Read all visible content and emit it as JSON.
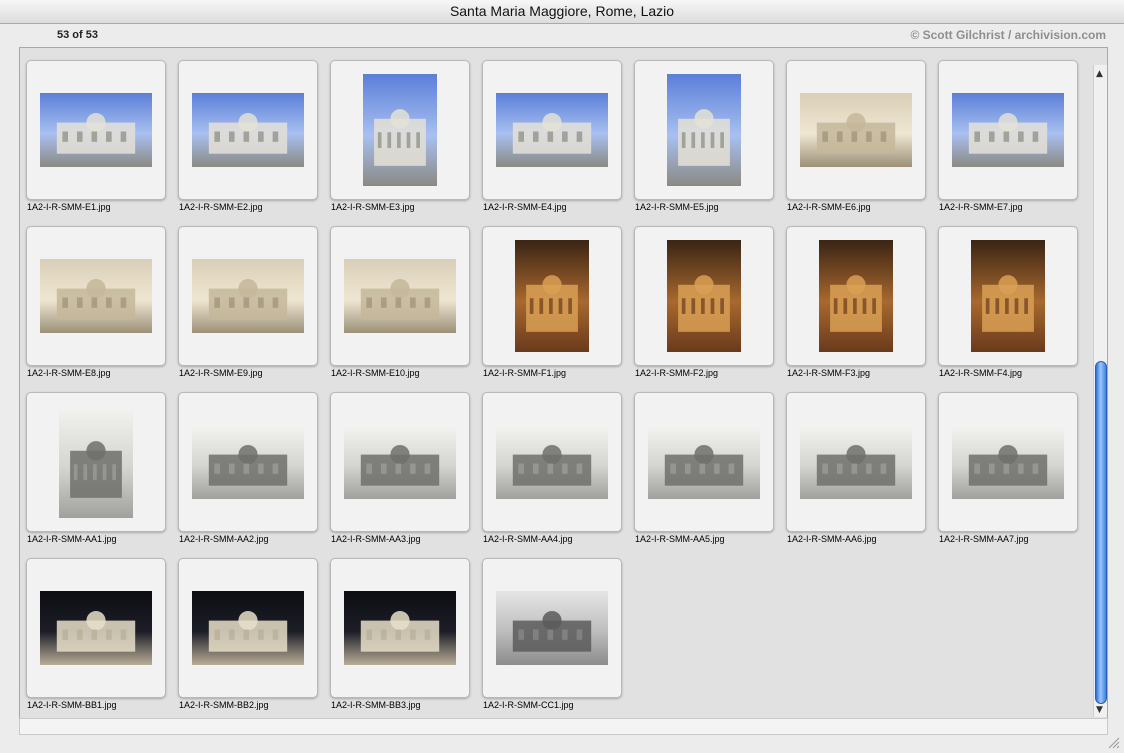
{
  "window": {
    "title": "Santa Maria Maggiore, Rome, Lazio"
  },
  "header": {
    "count": "53 of 53",
    "copyright": "© Scott Gilchrist / archivision.com"
  },
  "icons": {
    "scroll_up": "scroll-up-arrow-icon",
    "scroll_down": "scroll-down-arrow-icon",
    "resize": "resize-grip-icon"
  },
  "scrollbar": {
    "up_glyph": "▲",
    "down_glyph": "▼"
  },
  "grid": {
    "items": [
      {
        "file": "1A2-I-R-SMM-E1.jpg",
        "o": "l",
        "k": "exterior-photo"
      },
      {
        "file": "1A2-I-R-SMM-E2.jpg",
        "o": "l",
        "k": "exterior-photo"
      },
      {
        "file": "1A2-I-R-SMM-E3.jpg",
        "o": "p",
        "k": "exterior-photo"
      },
      {
        "file": "1A2-I-R-SMM-E4.jpg",
        "o": "l",
        "k": "exterior-photo"
      },
      {
        "file": "1A2-I-R-SMM-E5.jpg",
        "o": "p",
        "k": "exterior-photo"
      },
      {
        "file": "1A2-I-R-SMM-E6.jpg",
        "o": "l",
        "k": "facade-photo"
      },
      {
        "file": "1A2-I-R-SMM-E7.jpg",
        "o": "l",
        "k": "exterior-photo"
      },
      {
        "file": "1A2-I-R-SMM-E8.jpg",
        "o": "l",
        "k": "facade-photo"
      },
      {
        "file": "1A2-I-R-SMM-E9.jpg",
        "o": "l",
        "k": "facade-photo"
      },
      {
        "file": "1A2-I-R-SMM-E10.jpg",
        "o": "l",
        "k": "facade-photo"
      },
      {
        "file": "1A2-I-R-SMM-F1.jpg",
        "o": "p",
        "k": "interior-photo"
      },
      {
        "file": "1A2-I-R-SMM-F2.jpg",
        "o": "p",
        "k": "interior-photo"
      },
      {
        "file": "1A2-I-R-SMM-F3.jpg",
        "o": "p",
        "k": "interior-photo"
      },
      {
        "file": "1A2-I-R-SMM-F4.jpg",
        "o": "p",
        "k": "interior-photo"
      },
      {
        "file": "1A2-I-R-SMM-AA1.jpg",
        "o": "p",
        "k": "engraving"
      },
      {
        "file": "1A2-I-R-SMM-AA2.jpg",
        "o": "l",
        "k": "engraving"
      },
      {
        "file": "1A2-I-R-SMM-AA3.jpg",
        "o": "l",
        "k": "engraving"
      },
      {
        "file": "1A2-I-R-SMM-AA4.jpg",
        "o": "l",
        "k": "engraving"
      },
      {
        "file": "1A2-I-R-SMM-AA5.jpg",
        "o": "l",
        "k": "engraving"
      },
      {
        "file": "1A2-I-R-SMM-AA6.jpg",
        "o": "l",
        "k": "engraving"
      },
      {
        "file": "1A2-I-R-SMM-AA7.jpg",
        "o": "l",
        "k": "engraving"
      },
      {
        "file": "1A2-I-R-SMM-BB1.jpg",
        "o": "l",
        "k": "model-photo"
      },
      {
        "file": "1A2-I-R-SMM-BB2.jpg",
        "o": "l",
        "k": "model-photo"
      },
      {
        "file": "1A2-I-R-SMM-BB3.jpg",
        "o": "l",
        "k": "model-photo"
      },
      {
        "file": "1A2-I-R-SMM-CC1.jpg",
        "o": "l",
        "k": "bw-photo"
      }
    ]
  },
  "colors": {
    "exterior-photo": [
      "#5b7fd8",
      "#a8bff0",
      "#e4e0d6",
      "#8a8a82"
    ],
    "facade-photo": [
      "#d9cfb8",
      "#efe6d2",
      "#c4b79a",
      "#9c9078"
    ],
    "interior-photo": [
      "#3a2414",
      "#a8682e",
      "#d9a055",
      "#6a3a1c"
    ],
    "engraving": [
      "#f3f3f0",
      "#d4d4d0",
      "#6f6f6c",
      "#a0a09c"
    ],
    "model-photo": [
      "#0c0c12",
      "#1e1e28",
      "#e8dfc9",
      "#b8ad96"
    ],
    "bw-photo": [
      "#e6e6e6",
      "#bdbdbd",
      "#5a5a5a",
      "#8c8c8c"
    ]
  }
}
